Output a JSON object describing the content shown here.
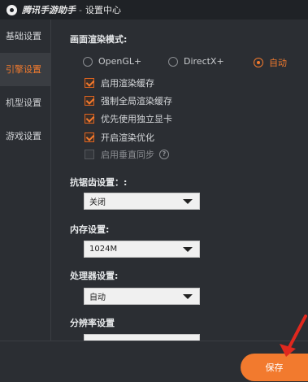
{
  "titlebar": {
    "app_name": "腾讯手游助手",
    "separator": "-",
    "window_title": "设置中心"
  },
  "sidebar": {
    "items": [
      {
        "label": "基础设置"
      },
      {
        "label": "引擎设置"
      },
      {
        "label": "机型设置"
      },
      {
        "label": "游戏设置"
      }
    ],
    "active_index": 1
  },
  "render": {
    "title": "画面渲染模式:",
    "options": [
      {
        "label": "OpenGL+"
      },
      {
        "label": "DirectX+"
      },
      {
        "label": "自动"
      }
    ],
    "selected": "自动",
    "checks": [
      {
        "label": "启用渲染缓存",
        "checked": true
      },
      {
        "label": "强制全局渲染缓存",
        "checked": true
      },
      {
        "label": "优先使用独立显卡",
        "checked": true
      },
      {
        "label": "开启渲染优化",
        "checked": true
      },
      {
        "label": "启用垂直同步",
        "checked": false
      }
    ]
  },
  "antialias": {
    "title": "抗锯齿设置：:",
    "value": "关闭"
  },
  "memory": {
    "title": "内存设置:",
    "value": "1024M"
  },
  "cpu": {
    "title": "处理器设置:",
    "value": "自动"
  },
  "resolution": {
    "title": "分辨率设置"
  },
  "footer": {
    "save_label": "保存"
  },
  "colors": {
    "accent": "#f27a2e",
    "background": "#2b2e33",
    "titlebar": "#1f2226",
    "annotation": "#e0281e"
  },
  "icons": {
    "logo": "app-logo-icon",
    "help": "help-icon",
    "dropdown": "chevron-down-icon"
  }
}
